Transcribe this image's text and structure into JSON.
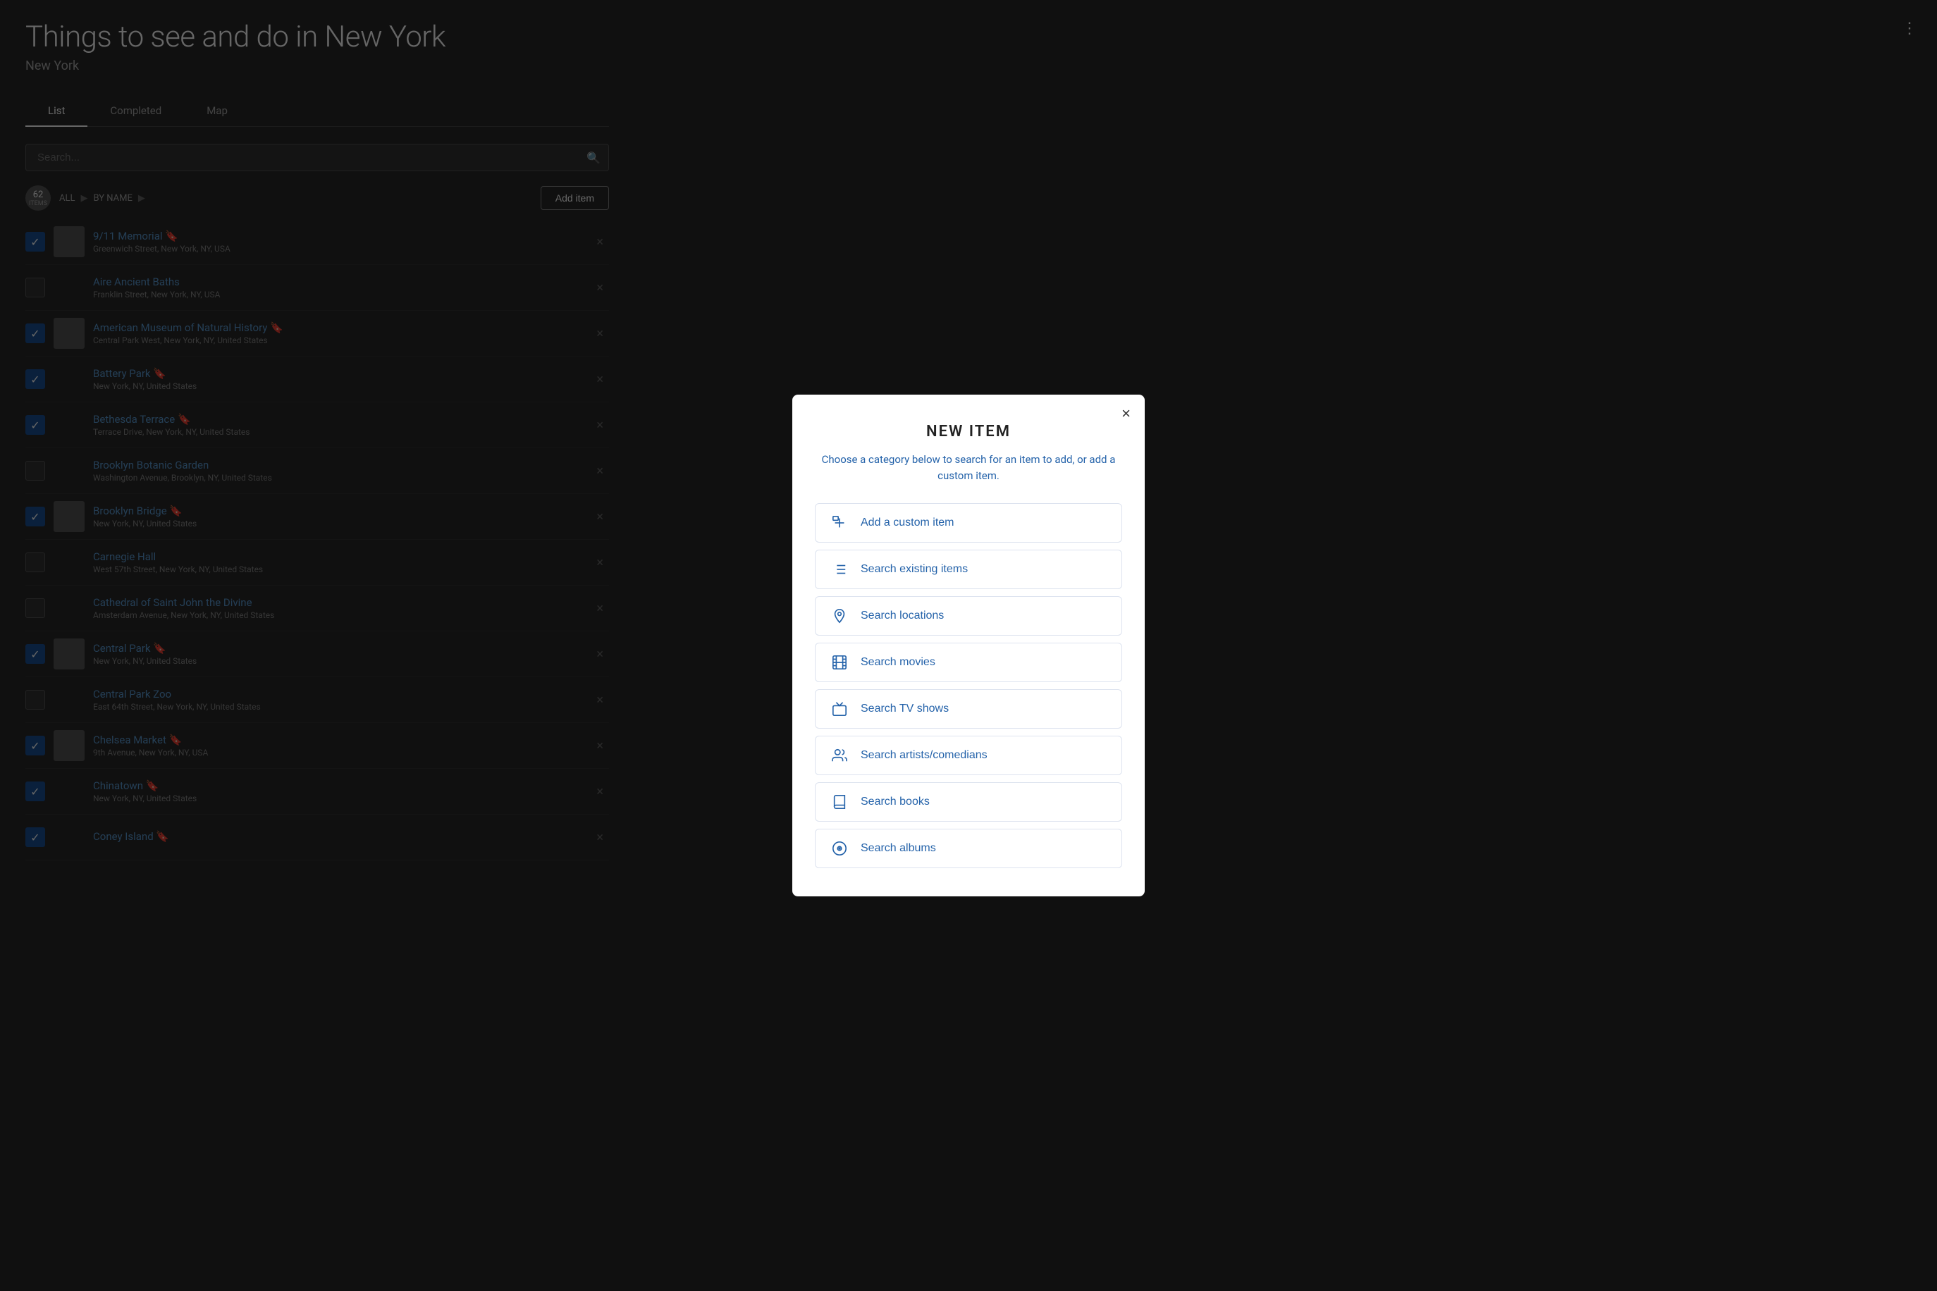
{
  "page": {
    "title": "Things to see and do in New York",
    "subtitle": "New York",
    "menu_icon": "⋮"
  },
  "tabs": [
    {
      "label": "List",
      "active": true
    },
    {
      "label": "Completed",
      "active": false
    },
    {
      "label": "Map",
      "active": false
    }
  ],
  "search": {
    "placeholder": "Search...",
    "icon": "🔍"
  },
  "list_meta": {
    "count": "62",
    "count_label": "ITEMS",
    "sort_all": "ALL",
    "sort_by_name": "BY NAME",
    "add_item_label": "Add item"
  },
  "items": [
    {
      "name": "9/11 Memorial",
      "address": "Greenwich Street, New York, NY, USA",
      "checked": true,
      "has_thumb": true,
      "has_icon": true
    },
    {
      "name": "Aire Ancient Baths",
      "address": "Franklin Street, New York, NY, USA",
      "checked": false,
      "has_thumb": false,
      "has_icon": false
    },
    {
      "name": "American Museum of Natural History",
      "address": "Central Park West, New York, NY, United States",
      "checked": true,
      "has_thumb": true,
      "has_icon": true
    },
    {
      "name": "Battery Park",
      "address": "New York, NY, United States",
      "checked": true,
      "has_thumb": false,
      "has_icon": true
    },
    {
      "name": "Bethesda Terrace",
      "address": "Terrace Drive, New York, NY, United States",
      "checked": true,
      "has_thumb": false,
      "has_icon": true
    },
    {
      "name": "Brooklyn Botanic Garden",
      "address": "Washington Avenue, Brooklyn, NY, United States",
      "checked": false,
      "has_thumb": false,
      "has_icon": false
    },
    {
      "name": "Brooklyn Bridge",
      "address": "New York, NY, United States",
      "checked": true,
      "has_thumb": true,
      "has_icon": true
    },
    {
      "name": "Carnegie Hall",
      "address": "West 57th Street, New York, NY, United States",
      "checked": false,
      "has_thumb": false,
      "has_icon": false
    },
    {
      "name": "Cathedral of Saint John the Divine",
      "address": "Amsterdam Avenue, New York, NY, United States",
      "checked": false,
      "has_thumb": false,
      "has_icon": false
    },
    {
      "name": "Central Park",
      "address": "New York, NY, United States",
      "checked": true,
      "has_thumb": true,
      "has_icon": true
    },
    {
      "name": "Central Park Zoo",
      "address": "East 64th Street, New York, NY, United States",
      "checked": false,
      "has_thumb": false,
      "has_icon": false
    },
    {
      "name": "Chelsea Market",
      "address": "9th Avenue, New York, NY, USA",
      "checked": true,
      "has_thumb": true,
      "has_icon": true
    },
    {
      "name": "Chinatown",
      "address": "New York, NY, United States",
      "checked": true,
      "has_thumb": false,
      "has_icon": true
    },
    {
      "name": "Coney Island",
      "address": "",
      "checked": true,
      "has_thumb": false,
      "has_icon": true
    }
  ],
  "modal": {
    "title": "NEW ITEM",
    "subtitle": "Choose a category below to search for an item to add, or add a custom item.",
    "close_label": "×",
    "options": [
      {
        "id": "add-custom",
        "label": "Add a custom item",
        "icon_type": "custom"
      },
      {
        "id": "search-existing",
        "label": "Search existing items",
        "icon_type": "list"
      },
      {
        "id": "search-locations",
        "label": "Search locations",
        "icon_type": "location"
      },
      {
        "id": "search-movies",
        "label": "Search movies",
        "icon_type": "movie"
      },
      {
        "id": "search-tv",
        "label": "Search TV shows",
        "icon_type": "tv"
      },
      {
        "id": "search-artists",
        "label": "Search artists/comedians",
        "icon_type": "artists"
      },
      {
        "id": "search-books",
        "label": "Search books",
        "icon_type": "book"
      },
      {
        "id": "search-albums",
        "label": "Search albums",
        "icon_type": "album"
      }
    ]
  }
}
